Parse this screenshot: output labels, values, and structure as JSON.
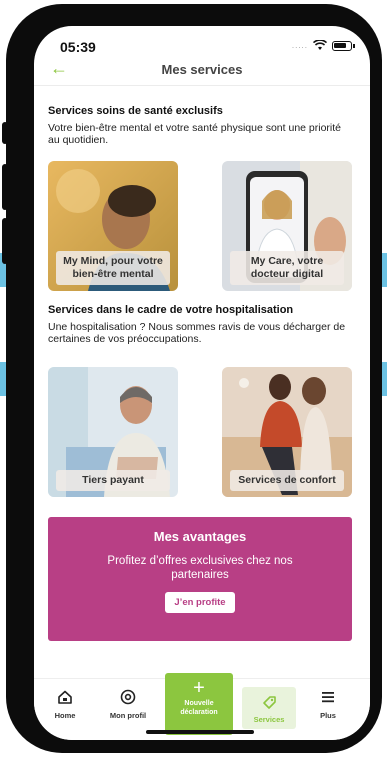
{
  "status_bar": {
    "time": "05:39",
    "signal": "....."
  },
  "header": {
    "title": "Mes services",
    "back_icon": "arrow-left-icon"
  },
  "sections": [
    {
      "title": "Services soins de santé exclusifs",
      "description": "Votre bien-être mental et votre santé physique sont une priorité au quotidien.",
      "cards": [
        {
          "label": "My Mind, pour votre bien-être mental"
        },
        {
          "label": "My Care, votre docteur digital"
        }
      ]
    },
    {
      "title": "Services dans le cadre de votre hospitalisation",
      "description": "Une hospitalisation ? Nous sommes ravis de vous décharger de certaines de vos préoccupations.",
      "cards": [
        {
          "label": "Tiers payant"
        },
        {
          "label": "Services de confort"
        }
      ]
    }
  ],
  "promo": {
    "title": "Mes avantages",
    "text": "Profitez d’offres exclusives chez nos partenaires",
    "button": "J’en profite"
  },
  "tabbar": {
    "items": [
      {
        "label": "Home",
        "icon": "home-icon"
      },
      {
        "label": "Mon profil",
        "icon": "profile-icon"
      },
      {
        "label": "Nouvelle déclaration",
        "icon": "plus-icon"
      },
      {
        "label": "Services",
        "icon": "tag-icon"
      },
      {
        "label": "Plus",
        "icon": "menu-icon"
      }
    ]
  },
  "colors": {
    "accent_green": "#8cc63f",
    "promo_magenta": "#b83f85",
    "side_tab_blue": "#6cc2e3"
  }
}
